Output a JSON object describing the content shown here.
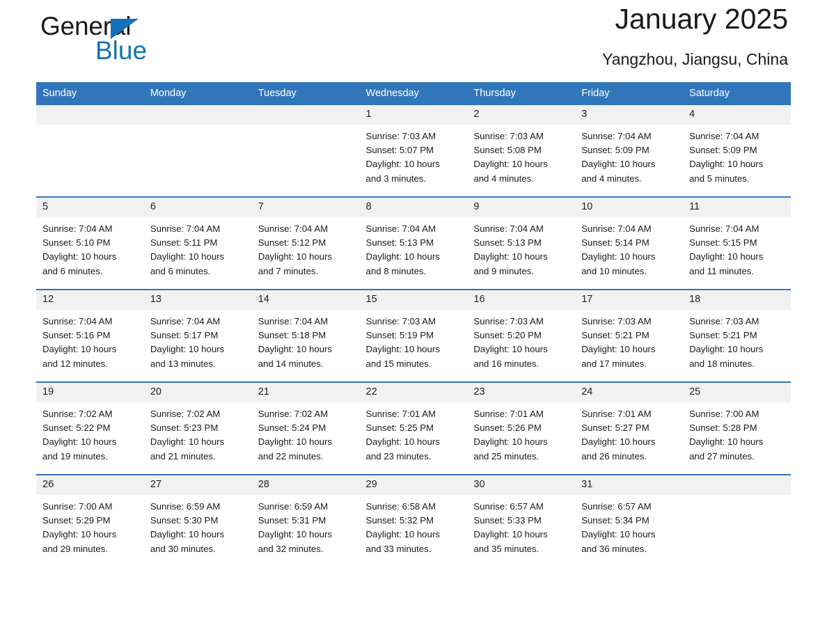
{
  "brand": {
    "word1": "General",
    "word2": "Blue",
    "triangle_color": "#1471b5"
  },
  "header": {
    "title": "January 2025",
    "location": "Yangzhou, Jiangsu, China",
    "header_bg": "#3176ba",
    "day_band_bg": "#f1f1f1"
  },
  "weekdays": [
    "Sunday",
    "Monday",
    "Tuesday",
    "Wednesday",
    "Thursday",
    "Friday",
    "Saturday"
  ],
  "weeks": [
    [
      {
        "day": "",
        "lines": []
      },
      {
        "day": "",
        "lines": []
      },
      {
        "day": "",
        "lines": []
      },
      {
        "day": "1",
        "lines": [
          "Sunrise: 7:03 AM",
          "Sunset: 5:07 PM",
          "Daylight: 10 hours",
          "and 3 minutes."
        ]
      },
      {
        "day": "2",
        "lines": [
          "Sunrise: 7:03 AM",
          "Sunset: 5:08 PM",
          "Daylight: 10 hours",
          "and 4 minutes."
        ]
      },
      {
        "day": "3",
        "lines": [
          "Sunrise: 7:04 AM",
          "Sunset: 5:09 PM",
          "Daylight: 10 hours",
          "and 4 minutes."
        ]
      },
      {
        "day": "4",
        "lines": [
          "Sunrise: 7:04 AM",
          "Sunset: 5:09 PM",
          "Daylight: 10 hours",
          "and 5 minutes."
        ]
      }
    ],
    [
      {
        "day": "5",
        "lines": [
          "Sunrise: 7:04 AM",
          "Sunset: 5:10 PM",
          "Daylight: 10 hours",
          "and 6 minutes."
        ]
      },
      {
        "day": "6",
        "lines": [
          "Sunrise: 7:04 AM",
          "Sunset: 5:11 PM",
          "Daylight: 10 hours",
          "and 6 minutes."
        ]
      },
      {
        "day": "7",
        "lines": [
          "Sunrise: 7:04 AM",
          "Sunset: 5:12 PM",
          "Daylight: 10 hours",
          "and 7 minutes."
        ]
      },
      {
        "day": "8",
        "lines": [
          "Sunrise: 7:04 AM",
          "Sunset: 5:13 PM",
          "Daylight: 10 hours",
          "and 8 minutes."
        ]
      },
      {
        "day": "9",
        "lines": [
          "Sunrise: 7:04 AM",
          "Sunset: 5:13 PM",
          "Daylight: 10 hours",
          "and 9 minutes."
        ]
      },
      {
        "day": "10",
        "lines": [
          "Sunrise: 7:04 AM",
          "Sunset: 5:14 PM",
          "Daylight: 10 hours",
          "and 10 minutes."
        ]
      },
      {
        "day": "11",
        "lines": [
          "Sunrise: 7:04 AM",
          "Sunset: 5:15 PM",
          "Daylight: 10 hours",
          "and 11 minutes."
        ]
      }
    ],
    [
      {
        "day": "12",
        "lines": [
          "Sunrise: 7:04 AM",
          "Sunset: 5:16 PM",
          "Daylight: 10 hours",
          "and 12 minutes."
        ]
      },
      {
        "day": "13",
        "lines": [
          "Sunrise: 7:04 AM",
          "Sunset: 5:17 PM",
          "Daylight: 10 hours",
          "and 13 minutes."
        ]
      },
      {
        "day": "14",
        "lines": [
          "Sunrise: 7:04 AM",
          "Sunset: 5:18 PM",
          "Daylight: 10 hours",
          "and 14 minutes."
        ]
      },
      {
        "day": "15",
        "lines": [
          "Sunrise: 7:03 AM",
          "Sunset: 5:19 PM",
          "Daylight: 10 hours",
          "and 15 minutes."
        ]
      },
      {
        "day": "16",
        "lines": [
          "Sunrise: 7:03 AM",
          "Sunset: 5:20 PM",
          "Daylight: 10 hours",
          "and 16 minutes."
        ]
      },
      {
        "day": "17",
        "lines": [
          "Sunrise: 7:03 AM",
          "Sunset: 5:21 PM",
          "Daylight: 10 hours",
          "and 17 minutes."
        ]
      },
      {
        "day": "18",
        "lines": [
          "Sunrise: 7:03 AM",
          "Sunset: 5:21 PM",
          "Daylight: 10 hours",
          "and 18 minutes."
        ]
      }
    ],
    [
      {
        "day": "19",
        "lines": [
          "Sunrise: 7:02 AM",
          "Sunset: 5:22 PM",
          "Daylight: 10 hours",
          "and 19 minutes."
        ]
      },
      {
        "day": "20",
        "lines": [
          "Sunrise: 7:02 AM",
          "Sunset: 5:23 PM",
          "Daylight: 10 hours",
          "and 21 minutes."
        ]
      },
      {
        "day": "21",
        "lines": [
          "Sunrise: 7:02 AM",
          "Sunset: 5:24 PM",
          "Daylight: 10 hours",
          "and 22 minutes."
        ]
      },
      {
        "day": "22",
        "lines": [
          "Sunrise: 7:01 AM",
          "Sunset: 5:25 PM",
          "Daylight: 10 hours",
          "and 23 minutes."
        ]
      },
      {
        "day": "23",
        "lines": [
          "Sunrise: 7:01 AM",
          "Sunset: 5:26 PM",
          "Daylight: 10 hours",
          "and 25 minutes."
        ]
      },
      {
        "day": "24",
        "lines": [
          "Sunrise: 7:01 AM",
          "Sunset: 5:27 PM",
          "Daylight: 10 hours",
          "and 26 minutes."
        ]
      },
      {
        "day": "25",
        "lines": [
          "Sunrise: 7:00 AM",
          "Sunset: 5:28 PM",
          "Daylight: 10 hours",
          "and 27 minutes."
        ]
      }
    ],
    [
      {
        "day": "26",
        "lines": [
          "Sunrise: 7:00 AM",
          "Sunset: 5:29 PM",
          "Daylight: 10 hours",
          "and 29 minutes."
        ]
      },
      {
        "day": "27",
        "lines": [
          "Sunrise: 6:59 AM",
          "Sunset: 5:30 PM",
          "Daylight: 10 hours",
          "and 30 minutes."
        ]
      },
      {
        "day": "28",
        "lines": [
          "Sunrise: 6:59 AM",
          "Sunset: 5:31 PM",
          "Daylight: 10 hours",
          "and 32 minutes."
        ]
      },
      {
        "day": "29",
        "lines": [
          "Sunrise: 6:58 AM",
          "Sunset: 5:32 PM",
          "Daylight: 10 hours",
          "and 33 minutes."
        ]
      },
      {
        "day": "30",
        "lines": [
          "Sunrise: 6:57 AM",
          "Sunset: 5:33 PM",
          "Daylight: 10 hours",
          "and 35 minutes."
        ]
      },
      {
        "day": "31",
        "lines": [
          "Sunrise: 6:57 AM",
          "Sunset: 5:34 PM",
          "Daylight: 10 hours",
          "and 36 minutes."
        ]
      },
      {
        "day": "",
        "lines": []
      }
    ]
  ]
}
